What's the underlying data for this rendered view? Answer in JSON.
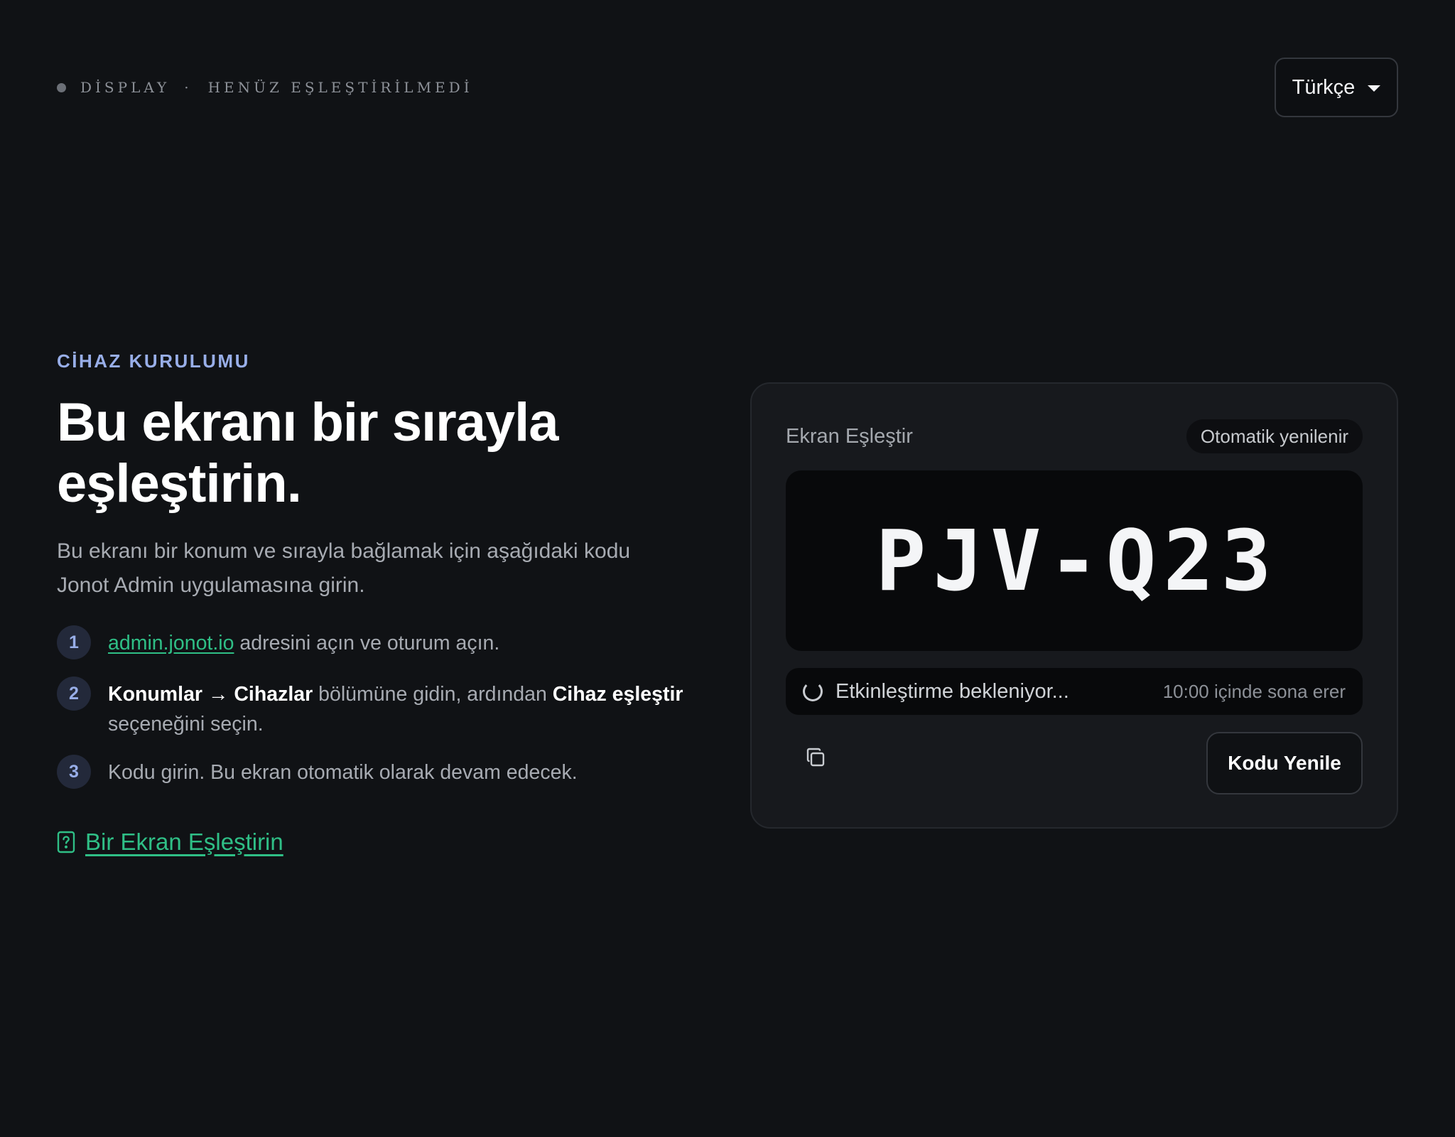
{
  "status": {
    "display_label": "DİSPLAY",
    "separator": "·",
    "pairing_state": "HENÜZ EŞLEŞTİRİLMEDİ"
  },
  "language": {
    "selected": "Türkçe"
  },
  "setup": {
    "eyebrow": "CİHAZ KURULUMU",
    "headline": "Bu ekranı bir sırayla eşleştirin.",
    "intro": "Bu ekranı bir konum ve sırayla bağlamak için aşağıdaki kodu Jonot Admin uygulamasına girin.",
    "steps": [
      {
        "number": "1",
        "link": "admin.jonot.io",
        "text": " adresini açın ve oturum açın."
      },
      {
        "number": "2",
        "bold1": "Konumlar → Cihazlar",
        "text1": " bölümüne gidin, ardından ",
        "bold2": "Cihaz eşleştir",
        "text2": " seçeneğini seçin."
      },
      {
        "number": "3",
        "text": "Kodu girin. Bu ekran otomatik olarak devam edecek."
      }
    ],
    "help_link": "Bir Ekran Eşleştirin"
  },
  "pair_card": {
    "title": "Ekran Eşleştir",
    "badge": "Otomatik yenilenir",
    "code": "PJV-Q23",
    "waiting_text": "Etkinleştirme bekleniyor...",
    "expires_text": "10:00 içinde sona erer",
    "refresh_label": "Kodu Yenile"
  },
  "icons": {
    "status_dot": "status-dot-icon",
    "dropdown": "chevron-down-icon",
    "help": "help-document-icon",
    "spinner": "spinner-icon",
    "copy": "copy-icon"
  },
  "colors": {
    "background": "#101215",
    "card": "#17191d",
    "accent_blue": "#98aee8",
    "accent_green": "#2fbf86",
    "text_primary": "#ffffff",
    "text_secondary": "#a7abb2"
  }
}
